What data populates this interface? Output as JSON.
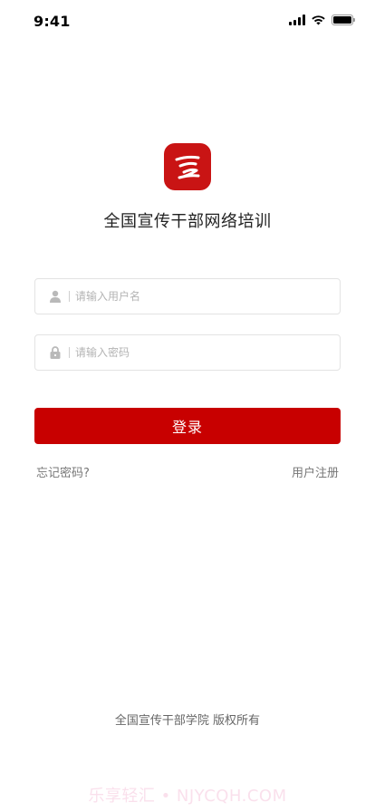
{
  "status_bar": {
    "time": "9:41"
  },
  "app": {
    "title": "全国宣传干部网络培训",
    "brand_color": "#c80000"
  },
  "login_form": {
    "username_placeholder": "请输入用户名",
    "password_placeholder": "请输入密码",
    "submit_label": "登录",
    "forgot_password_label": "忘记密码?",
    "register_label": "用户注册"
  },
  "footer": {
    "copyright": "全国宣传干部学院  版权所有"
  },
  "watermark": {
    "text": "乐享轻汇 • NJYCQH.COM"
  },
  "icons": {
    "username": "user-icon",
    "password": "lock-icon"
  }
}
